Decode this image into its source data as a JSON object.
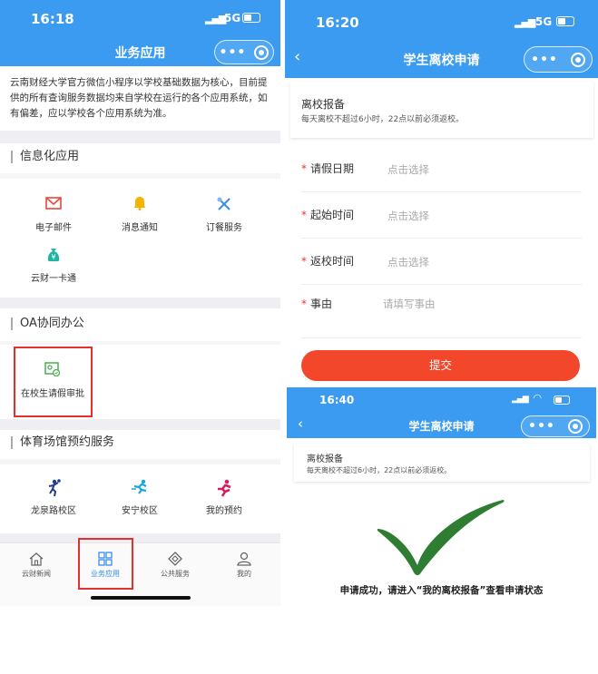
{
  "left": {
    "status": {
      "time": "16:18",
      "signal": "5G"
    },
    "nav": {
      "title": "业务应用"
    },
    "notice": "云南财经大学官方微信小程序以学校基础数据为核心，目前提供的所有查询服务数据均来自学校在运行的各个应用系统，如有偏差，应以学校各个应用系统为准。",
    "sections": {
      "info": {
        "title": "信息化应用",
        "items": [
          {
            "label": "电子邮件",
            "icon": "mail-icon",
            "color": "#e8483c"
          },
          {
            "label": "消息通知",
            "icon": "bell-icon",
            "color": "#f4b400"
          },
          {
            "label": "订餐服务",
            "icon": "fork-knife-icon",
            "color": "#3a8ee6"
          },
          {
            "label": "云财一卡通",
            "icon": "money-bag-icon",
            "color": "#1fb5a2"
          }
        ]
      },
      "oa": {
        "title": "OA协同办公",
        "items": [
          {
            "label": "在校生请假审批",
            "icon": "approval-icon",
            "color": "#4caf50"
          }
        ]
      },
      "sports": {
        "title": "体育场馆预约服务",
        "items": [
          {
            "label": "龙泉路校区",
            "icon": "basketball-player-icon",
            "color": "#243b8f"
          },
          {
            "label": "安宁校区",
            "icon": "runner-icon",
            "color": "#1aa6d8"
          },
          {
            "label": "我的预约",
            "icon": "sprinter-icon",
            "color": "#d81b60"
          }
        ]
      }
    },
    "tabbar": [
      {
        "label": "云财新闻",
        "icon": "home-icon"
      },
      {
        "label": "业务应用",
        "icon": "apps-icon"
      },
      {
        "label": "公共服务",
        "icon": "service-icon"
      },
      {
        "label": "我的",
        "icon": "person-icon"
      }
    ]
  },
  "right_top": {
    "status": {
      "time": "16:20",
      "signal": "5G"
    },
    "nav": {
      "title": "学生离校申请"
    },
    "card": {
      "title": "离校报备",
      "subtitle": "每天离校不超过6小时，22点以前必须返校。"
    },
    "form": [
      {
        "label": "请假日期",
        "placeholder": "点击选择"
      },
      {
        "label": "起始时间",
        "placeholder": "点击选择"
      },
      {
        "label": "返校时间",
        "placeholder": "点击选择"
      },
      {
        "label": "事由",
        "placeholder": "请填写事由"
      }
    ],
    "submit_label": "提交"
  },
  "right_bottom": {
    "status": {
      "time": "16:40"
    },
    "nav": {
      "title": "学生离校申请"
    },
    "card": {
      "title": "离校报备",
      "subtitle": "每天离校不超过6小时，22点以前必须返校。"
    },
    "success_text": "申请成功，请进入“我的离校报备”查看申请状态"
  },
  "colors": {
    "nav_blue": "#3a9bf0",
    "submit_red": "#f2472b",
    "check_green": "#2e7d32",
    "highlight_red": "#e03030"
  }
}
